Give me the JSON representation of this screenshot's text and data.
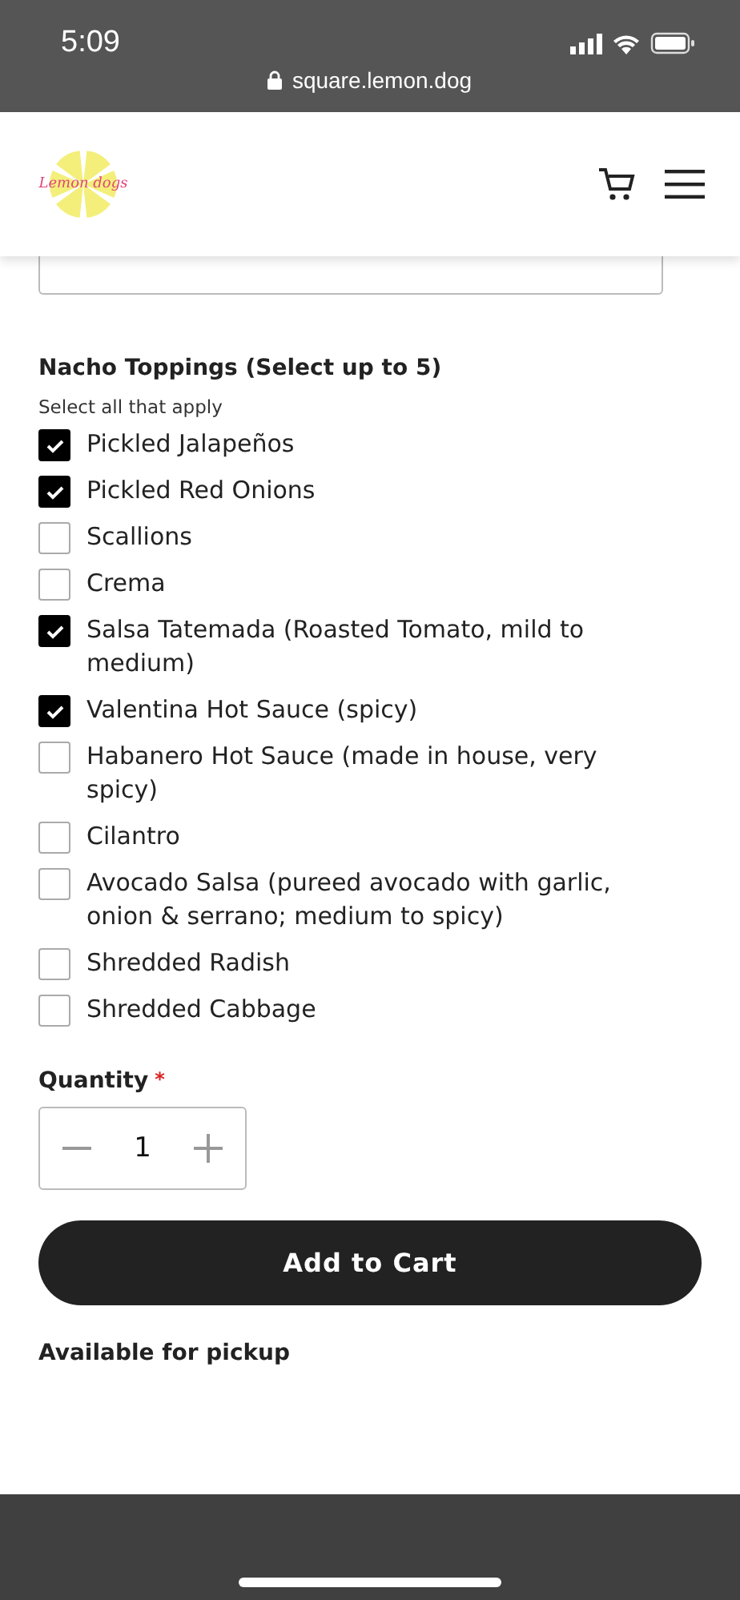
{
  "status_bar": {
    "time": "5:09",
    "url": "square.lemon.dog"
  },
  "header": {
    "logo_text": "Lemon dogs"
  },
  "toppings": {
    "title": "Nacho Toppings (Select up to 5)",
    "hint": "Select all that apply",
    "options": [
      {
        "label": "Pickled Jalapeños",
        "checked": true
      },
      {
        "label": "Pickled Red Onions",
        "checked": true
      },
      {
        "label": "Scallions",
        "checked": false
      },
      {
        "label": "Crema",
        "checked": false
      },
      {
        "label": "Salsa Tatemada (Roasted Tomato, mild to medium)",
        "checked": true
      },
      {
        "label": "Valentina Hot Sauce (spicy)",
        "checked": true
      },
      {
        "label": "Habanero Hot Sauce (made in house, very spicy)",
        "checked": false
      },
      {
        "label": "Cilantro",
        "checked": false
      },
      {
        "label": "Avocado Salsa (pureed avocado with garlic, onion & serrano; medium to spicy)",
        "checked": false
      },
      {
        "label": "Shredded Radish",
        "checked": false
      },
      {
        "label": "Shredded Cabbage",
        "checked": false
      }
    ]
  },
  "quantity": {
    "label": "Quantity",
    "required_mark": "*",
    "value": "1"
  },
  "add_button": "Add to Cart",
  "pickup_note": "Available for pickup"
}
